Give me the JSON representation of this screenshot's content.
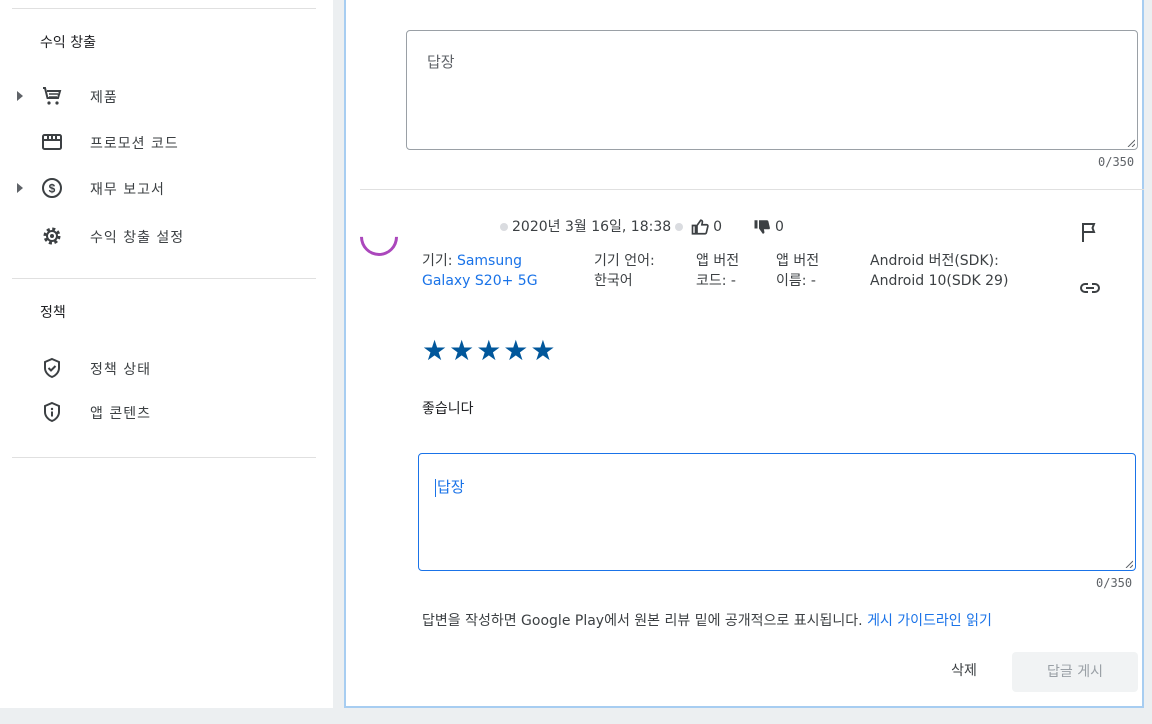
{
  "sidebar": {
    "monetization": {
      "title": "수익 창출",
      "items": [
        {
          "label": "제품",
          "icon": "cart-icon"
        },
        {
          "label": "프로모션 코드",
          "icon": "store-icon"
        },
        {
          "label": "재무 보고서",
          "icon": "dollar-circle-icon"
        },
        {
          "label": "수익 창출 설정",
          "icon": "gear-icon"
        }
      ]
    },
    "policy": {
      "title": "정책",
      "items": [
        {
          "label": "정책 상태",
          "icon": "shield-check-icon"
        },
        {
          "label": "앱 콘텐츠",
          "icon": "shield-info-icon"
        }
      ]
    }
  },
  "top_reply": {
    "placeholder": "답장",
    "counter": "0/350"
  },
  "review": {
    "date": "2020년 3월 16일, 18:38",
    "likes": "0",
    "dislikes": "0",
    "device_label": "기기:",
    "device_value_1": "Samsung",
    "device_value_2": "Galaxy S20+ 5G",
    "lang_label": "기기 언어:",
    "lang_value": "한국어",
    "app_code_label": "앱 버전",
    "app_code_label2": "코드: -",
    "app_name_label": "앱 버전",
    "app_name_label2": "이름: -",
    "android_label": "Android 버전(SDK):",
    "android_value": "Android 10(SDK 29)",
    "stars": "★★★★★",
    "rating": 5,
    "text": "좋습니다"
  },
  "reply": {
    "placeholder": "답장",
    "counter": "0/350",
    "notice": "답변을 작성하면 Google Play에서 원본 리뷰 밑에 공개적으로 표시됩니다.",
    "guideline_link": "게시 가이드라인 읽기",
    "delete_label": "삭제",
    "post_label": "답글 게시"
  },
  "colors": {
    "accent": "#1a73e8",
    "star": "#01579b",
    "avatar": "#ab47bc",
    "focus_border": "#a7cdf1"
  }
}
